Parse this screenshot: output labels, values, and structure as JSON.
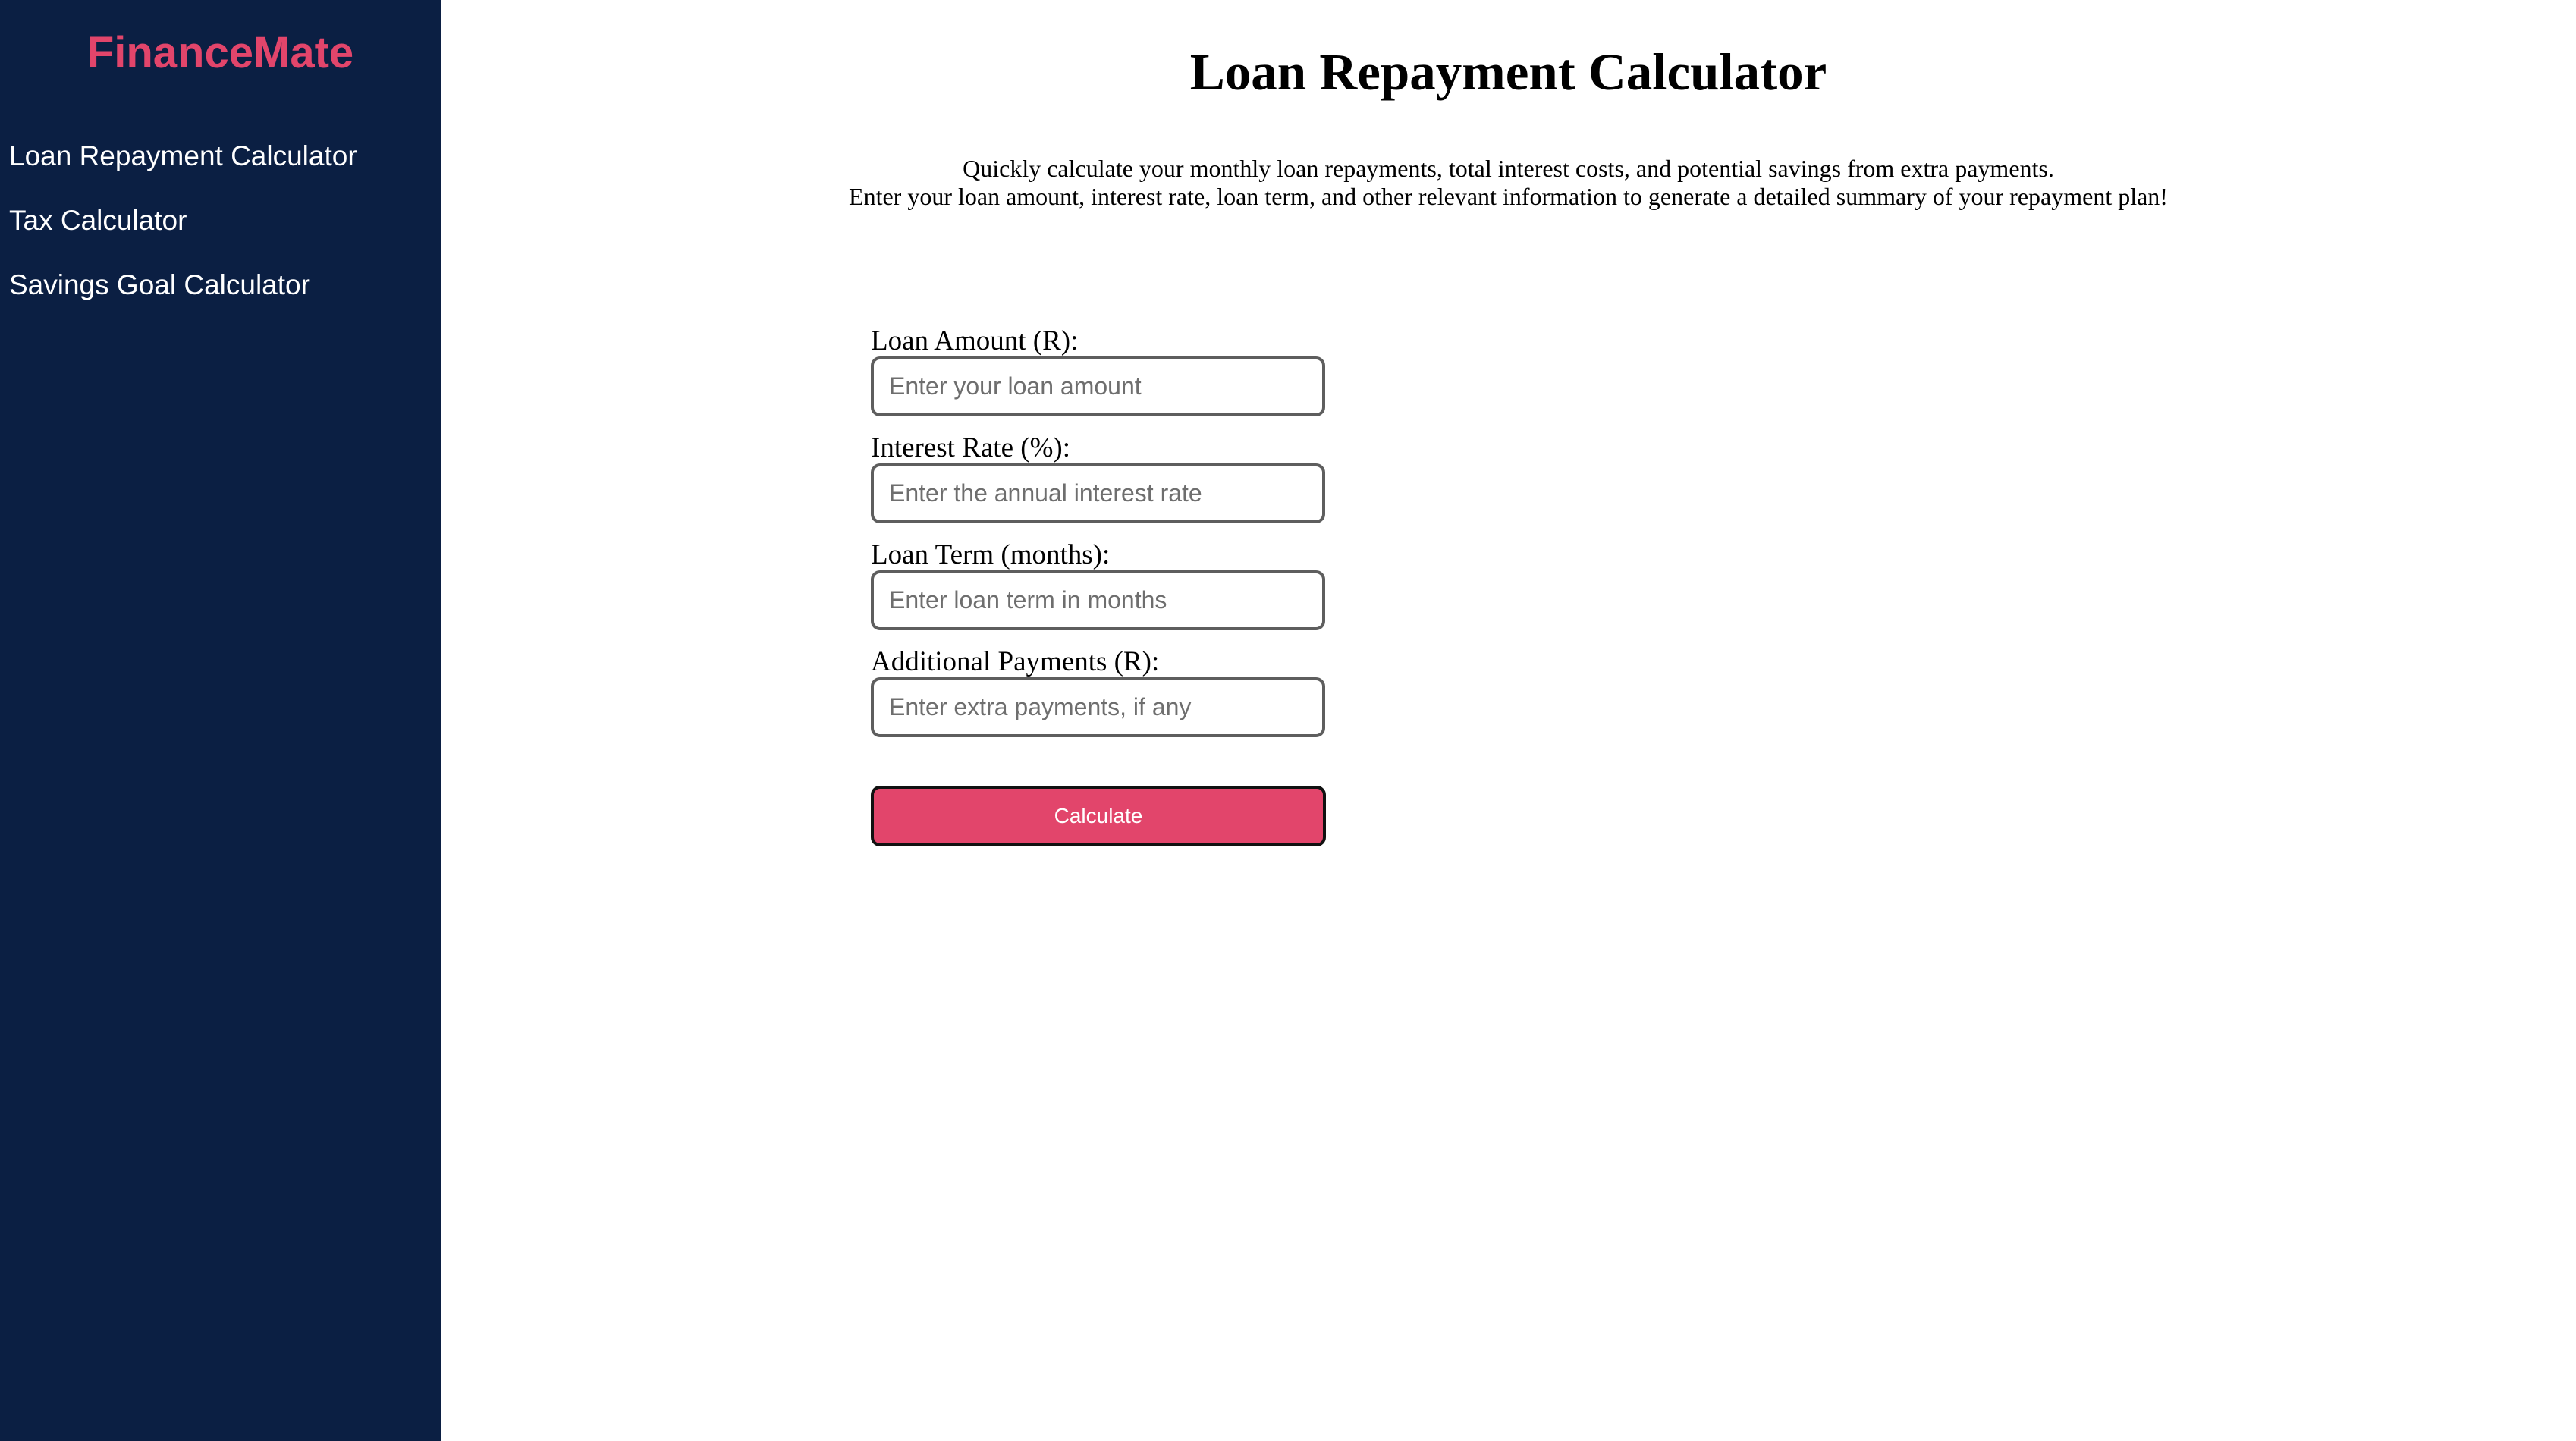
{
  "sidebar": {
    "brand": "FinanceMate",
    "items": [
      {
        "label": "Loan Repayment Calculator"
      },
      {
        "label": "Tax Calculator"
      },
      {
        "label": "Savings Goal Calculator"
      }
    ]
  },
  "main": {
    "title": "Loan Repayment Calculator",
    "intro_line1": "Quickly calculate your monthly loan repayments, total interest costs, and potential savings from extra payments.",
    "intro_line2": "Enter your loan amount, interest rate, loan term, and other relevant information to generate a detailed summary of your repayment plan!",
    "form": {
      "loan_amount": {
        "label": "Loan Amount (R):",
        "placeholder": "Enter your loan amount",
        "value": ""
      },
      "interest_rate": {
        "label": "Interest Rate (%):",
        "placeholder": "Enter the annual interest rate",
        "value": ""
      },
      "loan_term": {
        "label": "Loan Term (months):",
        "placeholder": "Enter loan term in months",
        "value": ""
      },
      "additional_payments": {
        "label": "Additional Payments (R):",
        "placeholder": "Enter extra payments, if any",
        "value": ""
      },
      "submit_label": "Calculate"
    }
  },
  "colors": {
    "sidebar_background": "#0b1f43",
    "brand_accent": "#e2456b",
    "button_background": "#e2456b",
    "nav_text": "#ffffff"
  }
}
